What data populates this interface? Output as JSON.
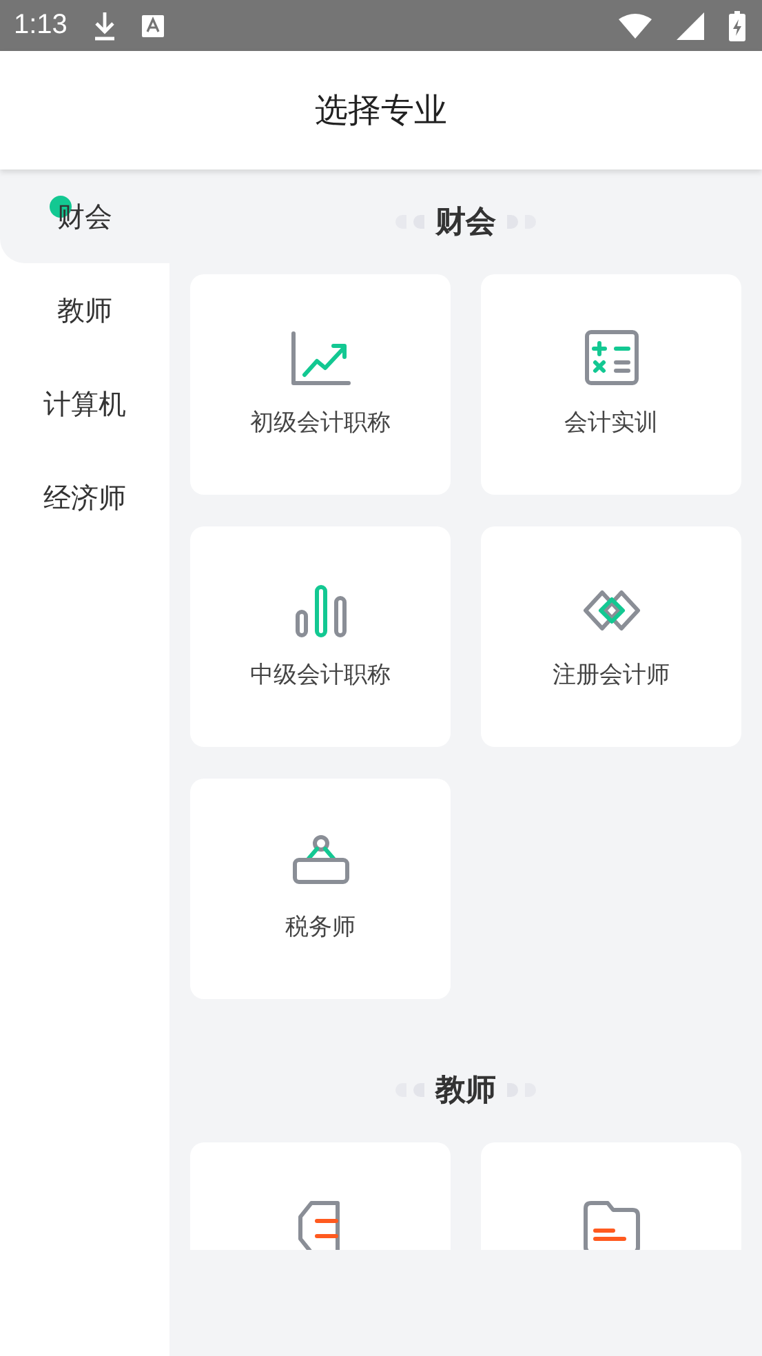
{
  "status_bar": {
    "time": "1:13"
  },
  "header": {
    "title": "选择专业"
  },
  "sidebar": {
    "items": [
      {
        "label": "财会",
        "selected": true,
        "dot": true
      },
      {
        "label": "教师",
        "selected": false,
        "dot": false
      },
      {
        "label": "计算机",
        "selected": false,
        "dot": false
      },
      {
        "label": "经济师",
        "selected": false,
        "dot": false
      }
    ]
  },
  "sections": [
    {
      "title": "财会",
      "cards": [
        {
          "kind": "chart",
          "label": "初级会计职称"
        },
        {
          "kind": "calculator",
          "label": "会计实训"
        },
        {
          "kind": "bars",
          "label": "中级会计职称"
        },
        {
          "kind": "diamonds",
          "label": "注册会计师"
        },
        {
          "kind": "hanger",
          "label": "税务师"
        }
      ]
    },
    {
      "title": "教师",
      "cards": [
        {
          "kind": "pencil"
        },
        {
          "kind": "folder"
        }
      ]
    }
  ]
}
